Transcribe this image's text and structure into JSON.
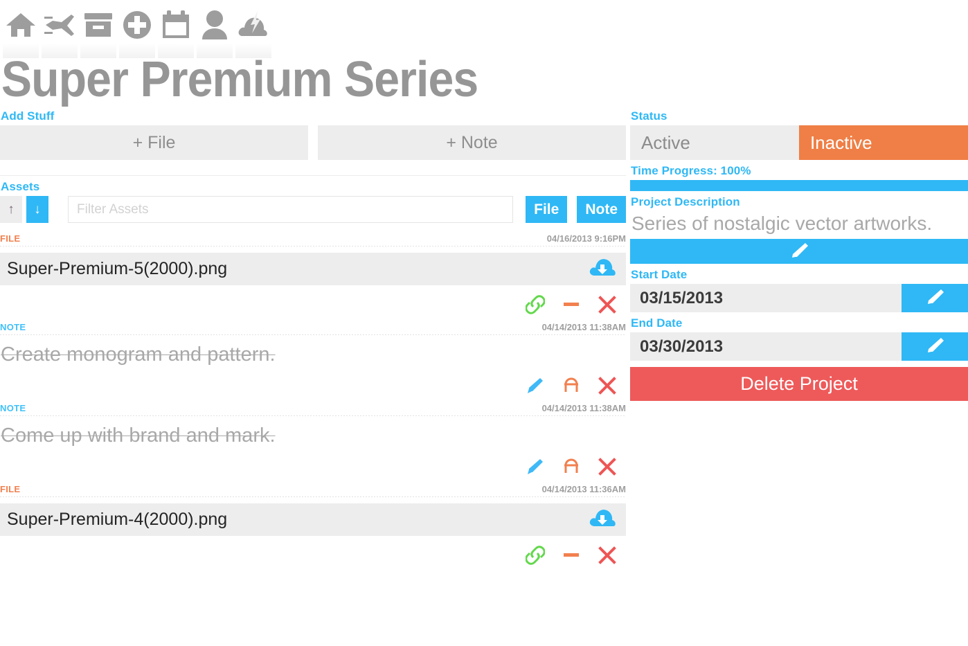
{
  "header": {
    "title": "Super Premium Series",
    "toolbar_icons": [
      {
        "name": "home-icon",
        "label": "Home"
      },
      {
        "name": "airplane-icon",
        "label": "Travel"
      },
      {
        "name": "archive-box-icon",
        "label": "Archive"
      },
      {
        "name": "plus-circle-icon",
        "label": "Add"
      },
      {
        "name": "calendar-icon",
        "label": "Calendar"
      },
      {
        "name": "user-icon",
        "label": "User"
      },
      {
        "name": "cloud-lightning-icon",
        "label": "Storm"
      }
    ]
  },
  "add_stuff": {
    "label": "Add Stuff",
    "add_file_label": "+ File",
    "add_note_label": "+ Note"
  },
  "assets_panel": {
    "label": "Assets",
    "sort_asc_icon": "↑",
    "sort_desc_icon": "↓",
    "filter_placeholder": "Filter Assets",
    "filter_value": "",
    "type_file_label": "File",
    "type_note_label": "Note"
  },
  "assets": [
    {
      "kind": "FILE",
      "kind_class": "file",
      "date": "04/16/2013 9:16PM",
      "name": "Super-Premium-5(2000).png",
      "download_icon": "cloud-download-icon",
      "actions": [
        {
          "name": "link-icon",
          "color": "#62d84b"
        },
        {
          "name": "minus-icon",
          "color": "#f2804f"
        },
        {
          "name": "close-x-icon",
          "color": "#ee5555"
        }
      ]
    },
    {
      "kind": "NOTE",
      "kind_class": "note",
      "date": "04/14/2013 11:38AM",
      "text": "Create monogram and pattern.",
      "actions": [
        {
          "name": "pencil-icon",
          "color": "#3fb9f7"
        },
        {
          "name": "reopen-icon",
          "color": "#f2804f"
        },
        {
          "name": "close-x-icon",
          "color": "#ee5555"
        }
      ]
    },
    {
      "kind": "NOTE",
      "kind_class": "note",
      "date": "04/14/2013 11:38AM",
      "text": "Come up with brand and mark.",
      "actions": [
        {
          "name": "pencil-icon",
          "color": "#3fb9f7"
        },
        {
          "name": "reopen-icon",
          "color": "#f2804f"
        },
        {
          "name": "close-x-icon",
          "color": "#ee5555"
        }
      ]
    },
    {
      "kind": "FILE",
      "kind_class": "file",
      "date": "04/14/2013 11:36AM",
      "name": "Super-Premium-4(2000).png",
      "download_icon": "cloud-download-icon",
      "actions": [
        {
          "name": "link-icon",
          "color": "#62d84b"
        },
        {
          "name": "minus-icon",
          "color": "#f2804f"
        },
        {
          "name": "close-x-icon",
          "color": "#ee5555"
        }
      ]
    }
  ],
  "sidebar": {
    "status_label": "Status",
    "status_active_label": "Active",
    "status_inactive_label": "Inactive",
    "status_selected": "Inactive",
    "progress_label": "Time Progress: 100%",
    "progress_percent": 100,
    "description_label": "Project Description",
    "description_text": "Series of nostalgic vector artworks.",
    "start_date_label": "Start Date",
    "start_date_value": "03/15/2013",
    "end_date_label": "End Date",
    "end_date_value": "03/30/2013",
    "delete_label": "Delete Project"
  },
  "colors": {
    "accent_blue": "#2fb8f5",
    "accent_orange": "#ef7f46",
    "danger_red": "#ee5a5a",
    "link_green": "#62d84b",
    "title_gray": "#969696",
    "panel_gray": "#ededed"
  }
}
